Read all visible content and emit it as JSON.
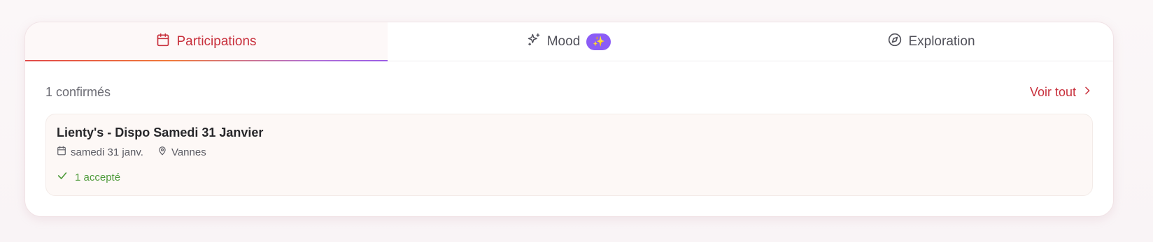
{
  "tabs": [
    {
      "label": "Participations",
      "icon": "calendar-icon",
      "active": true
    },
    {
      "label": "Mood",
      "icon": "sparkles-icon",
      "badge": "✨",
      "active": false
    },
    {
      "label": "Exploration",
      "icon": "compass-icon",
      "active": false
    }
  ],
  "section": {
    "count_text": "1 confirmés",
    "see_all_label": "Voir tout"
  },
  "event": {
    "title": "Lienty's - Dispo Samedi 31 Janvier",
    "date": "samedi 31 janv.",
    "location": "Vannes",
    "accepted_text": "1 accepté"
  },
  "colors": {
    "accent": "#c8303c",
    "badge": "#8b5cf6",
    "success": "#4e9a3a"
  }
}
